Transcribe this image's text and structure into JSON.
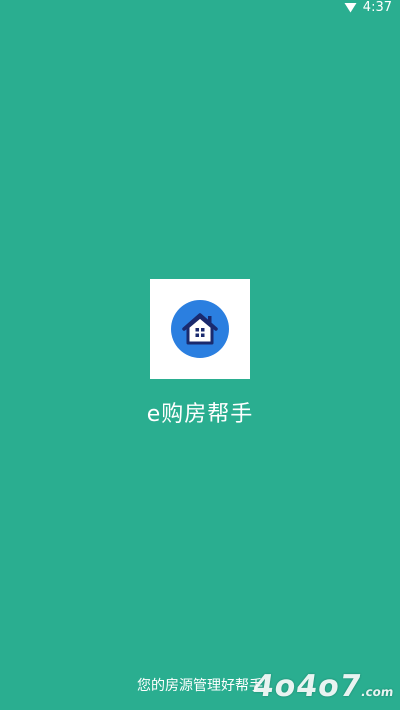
{
  "status_bar": {
    "time": "4:37",
    "signal_icon": "signal-icon"
  },
  "splash": {
    "logo_icon": "house-icon",
    "app_name": "e购房帮手",
    "slogan": "您的房源管理好帮手"
  },
  "watermark": {
    "main": "4o4o7",
    "suffix": ".com"
  },
  "colors": {
    "background": "#2aae90",
    "logo_circle": "#2b7fe0",
    "logo_house": "#1a2a6e"
  }
}
